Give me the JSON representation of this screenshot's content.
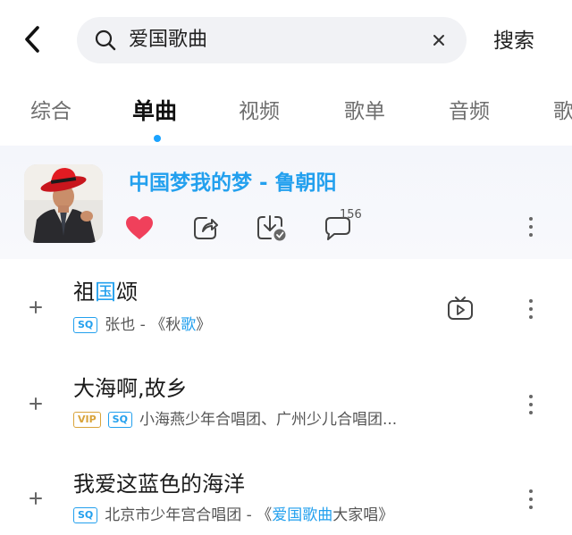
{
  "header": {
    "back_icon": "chevron-left-icon",
    "search_query": "爱国歌曲",
    "search_button": "搜索"
  },
  "tabs": [
    {
      "label": "综合",
      "active": false
    },
    {
      "label": "单曲",
      "active": true
    },
    {
      "label": "视频",
      "active": false
    },
    {
      "label": "歌单",
      "active": false
    },
    {
      "label": "音频",
      "active": false
    },
    {
      "label": "歌",
      "active": false
    }
  ],
  "featured": {
    "title": "中国梦我的梦 - 鲁朝阳",
    "comment_count": "156",
    "colors": {
      "accent": "#23a0ee",
      "heart": "#f0405b"
    }
  },
  "songs": [
    {
      "title_parts": [
        "祖",
        "国",
        "颂"
      ],
      "badges": [
        "SQ"
      ],
      "meta_parts": [
        "张也 - 《秋",
        "歌",
        "》"
      ]
    },
    {
      "title_parts": [
        "大海啊,故乡"
      ],
      "badges": [
        "VIP",
        "SQ"
      ],
      "meta_parts": [
        "小海燕少年合唱团、广州少儿合唱团..."
      ]
    },
    {
      "title_parts": [
        "我爱这蓝色的海洋"
      ],
      "badges": [
        "SQ"
      ],
      "meta_parts": [
        "北京市少年宫合唱团 - 《",
        "爱国歌曲",
        "大家唱》"
      ]
    }
  ]
}
